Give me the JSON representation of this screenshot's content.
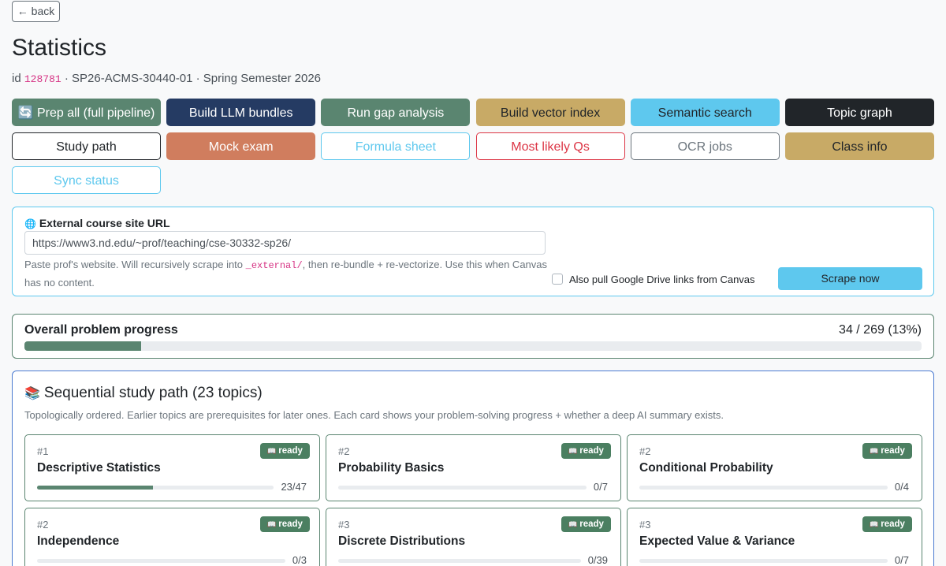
{
  "nav": {
    "back_label": "← back"
  },
  "page": {
    "title": "Statistics",
    "id_prefix": "id",
    "id_value": "128781",
    "course_code": "· SP26-ACMS-30440-01 · Spring Semester 2026"
  },
  "actions": [
    {
      "label": "🔄 Prep all (full pipeline)",
      "style": "solid-teal",
      "name": "prep-all-button"
    },
    {
      "label": "Build LLM bundles",
      "style": "solid-navy",
      "name": "build-llm-bundles-button"
    },
    {
      "label": "Run gap analysis",
      "style": "solid-teal",
      "name": "run-gap-analysis-button"
    },
    {
      "label": "Build vector index",
      "style": "solid-gold",
      "name": "build-vector-index-button"
    },
    {
      "label": "Semantic search",
      "style": "solid-cyan",
      "name": "semantic-search-button"
    },
    {
      "label": "Topic graph",
      "style": "solid-dark",
      "name": "topic-graph-button"
    },
    {
      "label": "Study path",
      "style": "outline-dark",
      "name": "study-path-button"
    },
    {
      "label": "Mock exam",
      "style": "solid-orange",
      "name": "mock-exam-button"
    },
    {
      "label": "Formula sheet",
      "style": "outline-cyan",
      "name": "formula-sheet-button"
    },
    {
      "label": "Most likely Qs",
      "style": "outline-red",
      "name": "most-likely-qs-button"
    },
    {
      "label": "OCR jobs",
      "style": "outline-gray",
      "name": "ocr-jobs-button"
    },
    {
      "label": "Class info",
      "style": "solid-gold",
      "name": "class-info-button"
    },
    {
      "label": "Sync status",
      "style": "outline-cyan",
      "name": "sync-status-button"
    }
  ],
  "external": {
    "icon": "🌐",
    "label": "External course site URL",
    "url_value": "https://www3.nd.edu/~prof/teaching/cse-30332-sp26/",
    "help_before": "Paste prof's website. Will recursively scrape into ",
    "help_code": "_external/",
    "help_after": ", then re-bundle + re-vectorize. Use this when Canvas has no content.",
    "checkbox_label": "Also pull Google Drive links from Canvas",
    "checkbox_checked": false,
    "scrape_label": "Scrape now"
  },
  "progress": {
    "title": "Overall problem progress",
    "count_text": "34 / 269 (13%)",
    "fraction": 0.13
  },
  "study_path": {
    "icon": "📚",
    "title": "Sequential study path (23 topics)",
    "description": "Topologically ordered. Earlier topics are prerequisites for later ones. Each card shows your problem-solving progress + whether a deep AI summary exists.",
    "topics": [
      {
        "num": "#1",
        "name": "Descriptive Statistics",
        "badge_icon": "📖",
        "badge": "ready",
        "done": 23,
        "total": 47,
        "count": "23/47"
      },
      {
        "num": "#2",
        "name": "Probability Basics",
        "badge_icon": "📖",
        "badge": "ready",
        "done": 0,
        "total": 7,
        "count": "0/7"
      },
      {
        "num": "#2",
        "name": "Conditional Probability",
        "badge_icon": "📖",
        "badge": "ready",
        "done": 0,
        "total": 4,
        "count": "0/4"
      },
      {
        "num": "#2",
        "name": "Independence",
        "badge_icon": "📖",
        "badge": "ready",
        "done": 0,
        "total": 3,
        "count": "0/3"
      },
      {
        "num": "#3",
        "name": "Discrete Distributions",
        "badge_icon": "📖",
        "badge": "ready",
        "done": 0,
        "total": 39,
        "count": "0/39"
      },
      {
        "num": "#3",
        "name": "Expected Value & Variance",
        "badge_icon": "📖",
        "badge": "ready",
        "done": 0,
        "total": 7,
        "count": "0/7"
      }
    ]
  }
}
